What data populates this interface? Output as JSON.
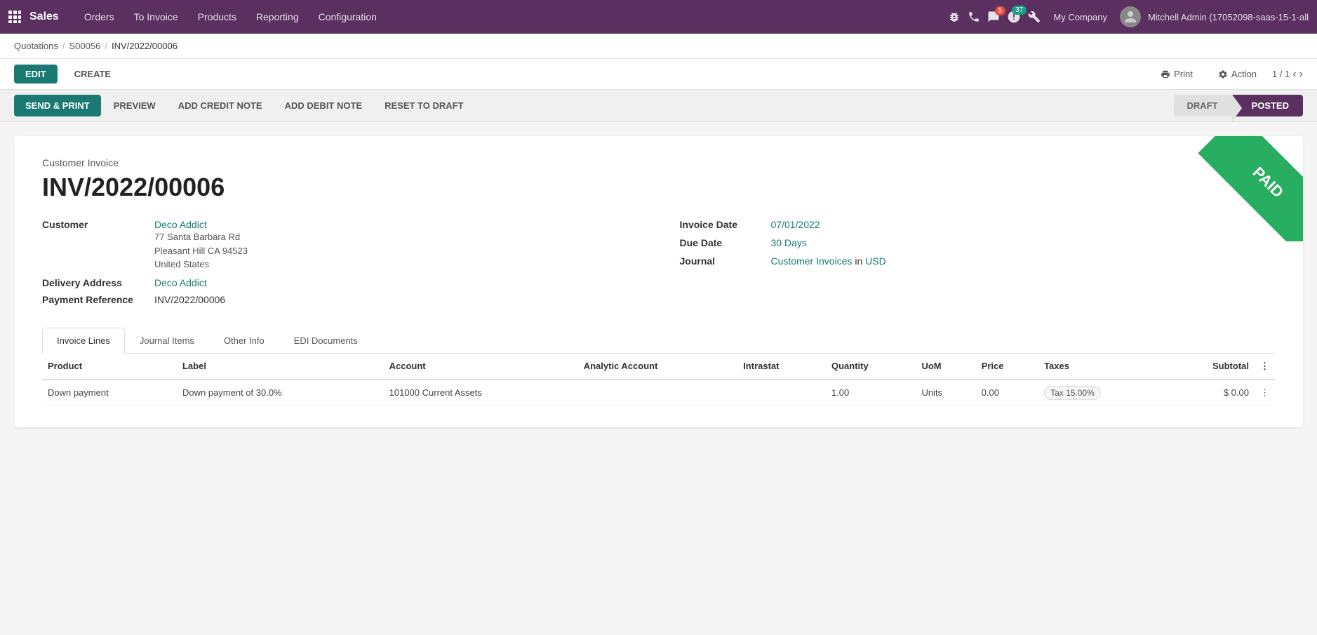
{
  "app": {
    "name": "Sales",
    "grid_icon": "⊞"
  },
  "nav": {
    "items": [
      {
        "id": "orders",
        "label": "Orders"
      },
      {
        "id": "to-invoice",
        "label": "To Invoice"
      },
      {
        "id": "products",
        "label": "Products"
      },
      {
        "id": "reporting",
        "label": "Reporting"
      },
      {
        "id": "configuration",
        "label": "Configuration"
      }
    ]
  },
  "topbar_icons": {
    "bug": "🐛",
    "phone": "📞",
    "chat_badge": "5",
    "refresh_badge": "37",
    "tools": "🔧",
    "company": "My Company",
    "user": "Mitchell Admin (17052098-saas-15-1-all"
  },
  "breadcrumb": {
    "items": [
      "Quotations",
      "S00056",
      "INV/2022/00006"
    ]
  },
  "action_bar": {
    "edit_label": "EDIT",
    "create_label": "CREATE",
    "print_label": "Print",
    "action_label": "Action",
    "pagination": "1 / 1"
  },
  "status_bar": {
    "send_print_label": "SEND & PRINT",
    "preview_label": "PREVIEW",
    "add_credit_note_label": "ADD CREDIT NOTE",
    "add_debit_note_label": "ADD DEBIT NOTE",
    "reset_to_draft_label": "RESET TO DRAFT",
    "steps": [
      {
        "id": "draft",
        "label": "DRAFT"
      },
      {
        "id": "posted",
        "label": "POSTED"
      }
    ],
    "active_step": "posted"
  },
  "invoice": {
    "type": "Customer Invoice",
    "number": "INV/2022/00006",
    "paid_label": "PAID",
    "customer_label": "Customer",
    "customer_name": "Deco Addict",
    "customer_address_line1": "77 Santa Barbara Rd",
    "customer_address_line2": "Pleasant Hill CA 94523",
    "customer_address_line3": "United States",
    "delivery_address_label": "Delivery Address",
    "delivery_address_name": "Deco Addict",
    "payment_ref_label": "Payment Reference",
    "payment_ref_value": "INV/2022/00006",
    "invoice_date_label": "Invoice Date",
    "invoice_date_value": "07/01/2022",
    "due_date_label": "Due Date",
    "due_date_value": "30 Days",
    "journal_label": "Journal",
    "journal_value": "Customer Invoices",
    "journal_in": "in",
    "journal_currency": "USD"
  },
  "tabs": [
    {
      "id": "invoice-lines",
      "label": "Invoice Lines"
    },
    {
      "id": "journal-items",
      "label": "Journal Items"
    },
    {
      "id": "other-info",
      "label": "Other Info"
    },
    {
      "id": "edi-documents",
      "label": "EDI Documents"
    }
  ],
  "active_tab": "invoice-lines",
  "table": {
    "columns": [
      {
        "id": "product",
        "label": "Product"
      },
      {
        "id": "label",
        "label": "Label"
      },
      {
        "id": "account",
        "label": "Account"
      },
      {
        "id": "analytic-account",
        "label": "Analytic Account"
      },
      {
        "id": "intrastat",
        "label": "Intrastat"
      },
      {
        "id": "quantity",
        "label": "Quantity"
      },
      {
        "id": "uom",
        "label": "UoM"
      },
      {
        "id": "price",
        "label": "Price"
      },
      {
        "id": "taxes",
        "label": "Taxes"
      },
      {
        "id": "subtotal",
        "label": "Subtotal"
      }
    ],
    "rows": [
      {
        "product": "Down payment",
        "label": "Down payment of 30.0%",
        "account": "101000 Current Assets",
        "analytic_account": "",
        "intrastat": "",
        "quantity": "1.00",
        "uom": "Units",
        "price": "0.00",
        "taxes": "Tax 15.00%",
        "subtotal": "$ 0.00"
      }
    ]
  }
}
